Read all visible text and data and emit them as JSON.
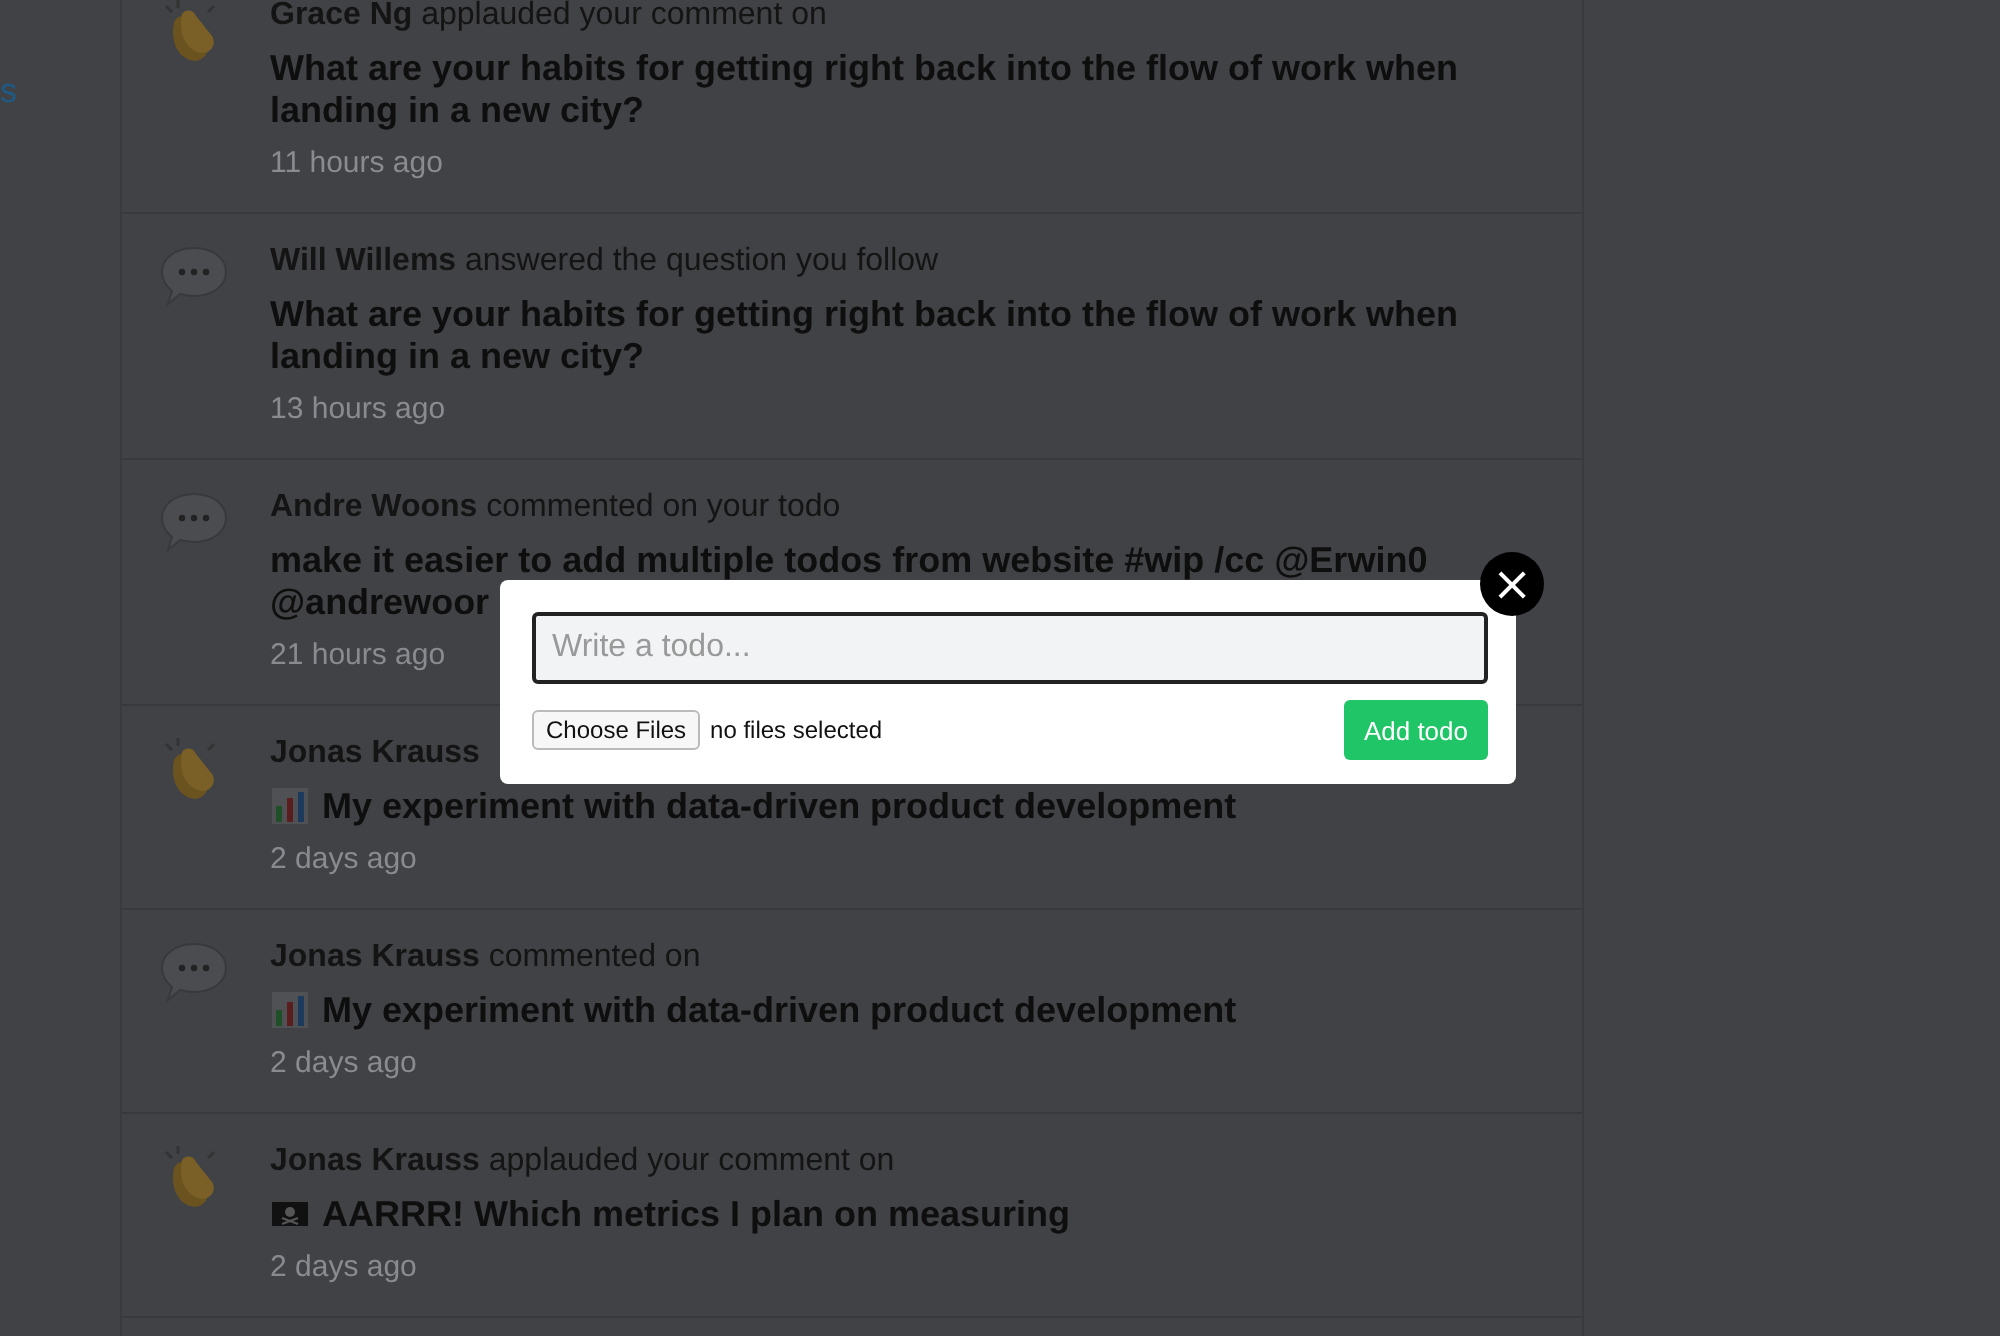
{
  "sidebar": {
    "link": "s"
  },
  "feed": [
    {
      "kind": "applause",
      "actor": "Grace Ng",
      "action": "applauded your comment on",
      "title": {
        "text": "What are your habits for getting right back into the flow of work when landing in a new city?"
      },
      "time": "11 hours ago"
    },
    {
      "kind": "comment",
      "actor": "Will Willems",
      "action": "answered the question you follow",
      "title": {
        "text": "What are your habits for getting right back into the flow of work when landing in a new city?"
      },
      "time": "13 hours ago"
    },
    {
      "kind": "comment",
      "actor": "Andre Woons",
      "action": "commented on your todo",
      "title": {
        "text": "make it easier to add multiple todos from website #wip /cc @Erwin0 @andrewoor"
      },
      "time": "21 hours ago"
    },
    {
      "kind": "applause",
      "actor": "Jonas Krauss",
      "title": {
        "kind": "chart",
        "text": "My experiment with data-driven product development"
      },
      "time": "2 days ago"
    },
    {
      "kind": "comment",
      "actor": "Jonas Krauss",
      "action": "commented on",
      "title": {
        "kind": "chart",
        "text": "My experiment with data-driven product development"
      },
      "time": "2 days ago"
    },
    {
      "kind": "applause",
      "actor": "Jonas Krauss",
      "action": "applauded your comment on",
      "title": {
        "kind": "flag",
        "text": "AARRR! Which metrics I plan on measuring"
      },
      "time": "2 days ago"
    }
  ],
  "modal": {
    "placeholder": "Write a todo...",
    "file_button": "Choose Files",
    "file_status": "no files selected",
    "submit": "Add todo",
    "close": "×"
  }
}
